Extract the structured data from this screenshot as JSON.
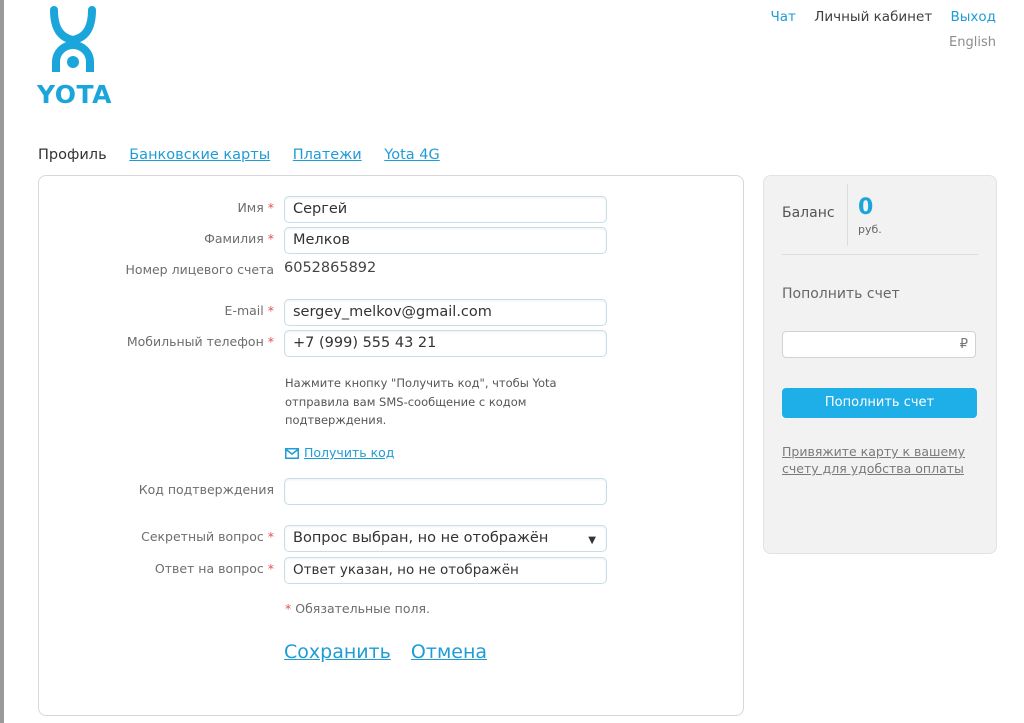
{
  "brand": {
    "name": "YOTA",
    "color": "#1ba6db",
    "logo_icon": "yota-logo-icon"
  },
  "header": {
    "links": [
      "Чат",
      "Личный кабинет",
      "Выход"
    ],
    "language": "English"
  },
  "tabs": [
    {
      "label": "Профиль",
      "active": true
    },
    {
      "label": "Банковские карты",
      "active": false
    },
    {
      "label": "Платежи",
      "active": false
    },
    {
      "label": "Yota 4G",
      "active": false
    }
  ],
  "profile": {
    "first_name": {
      "label": "Имя",
      "value": "Сергей"
    },
    "last_name": {
      "label": "Фамилия",
      "value": "Мелков"
    },
    "account": {
      "label": "Номер лицевого счета",
      "value": "6052865892"
    },
    "email": {
      "label": "E-mail",
      "value": "sergey_melkov@gmail.com"
    },
    "phone": {
      "label": "Мобильный телефон",
      "value": "+7 (999) 555 43 21"
    },
    "hint": "Нажмите кнопку \"Получить код\", чтобы Yota отправила вам SMS-сообщение с кодом подтверждения.",
    "get_code": {
      "label": "Получить код",
      "icon": "envelope-icon"
    },
    "confirmation_code": {
      "label": "Код подтверждения",
      "value": ""
    },
    "secret_question": {
      "label": "Секретный вопрос",
      "value": "Вопрос выбран, но не отображён"
    },
    "secret_answer": {
      "label": "Ответ на вопрос",
      "value": "Ответ указан, но не отображён"
    },
    "required_star": "*",
    "required_note": "Обязательные поля.",
    "save": "Сохранить",
    "cancel": "Отмена"
  },
  "sidebar": {
    "balance_label": "Баланс",
    "balance_value": "0",
    "balance_unit": "руб.",
    "topup_title": "Пополнить счет",
    "currency_sign": "₽",
    "topup_button": "Пополнить счет",
    "bind_card_link": "Привяжите карту к вашему счету для удобства оплаты"
  },
  "colors": {
    "accent": "#1f9cd6",
    "button": "#1eaee8",
    "required": "#e2524c"
  }
}
